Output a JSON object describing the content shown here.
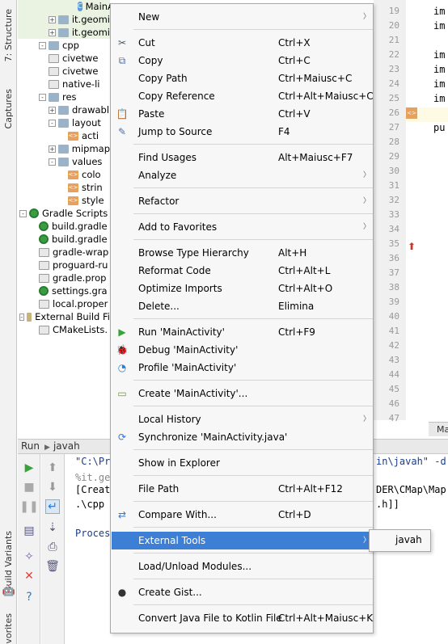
{
  "left_strip": {
    "tabs": [
      "7: Structure",
      "Captures",
      "Build Variants",
      "vorites"
    ]
  },
  "project_tree": {
    "rows": [
      {
        "label": "MainActivi",
        "icon": "class-icon",
        "indent": 6,
        "toggle": "",
        "hl": true
      },
      {
        "label": "it.geomi",
        "icon": "folder-icon",
        "indent": 3,
        "toggle": "+",
        "hl": true
      },
      {
        "label": "it.geomi",
        "icon": "folder-icon",
        "indent": 3,
        "toggle": "+",
        "hl": true
      },
      {
        "label": "cpp",
        "icon": "folder-icon",
        "indent": 2,
        "toggle": "-",
        "hl": false
      },
      {
        "label": "civetwe",
        "icon": "c-file-icon",
        "indent": 3,
        "toggle": "",
        "hl": false
      },
      {
        "label": "civetwe",
        "icon": "h-file-icon",
        "indent": 3,
        "toggle": "",
        "hl": false
      },
      {
        "label": "native-li",
        "icon": "cpp-file-icon",
        "indent": 3,
        "toggle": "",
        "hl": false
      },
      {
        "label": "res",
        "icon": "folder-icon",
        "indent": 2,
        "toggle": "-",
        "hl": false
      },
      {
        "label": "drawabl",
        "icon": "folder-icon",
        "indent": 3,
        "toggle": "+",
        "hl": false
      },
      {
        "label": "layout",
        "icon": "folder-icon",
        "indent": 3,
        "toggle": "-",
        "hl": false
      },
      {
        "label": "acti",
        "icon": "xml-file-icon",
        "indent": 5,
        "toggle": "",
        "hl": false
      },
      {
        "label": "mipmap",
        "icon": "folder-icon",
        "indent": 3,
        "toggle": "+",
        "hl": false
      },
      {
        "label": "values",
        "icon": "folder-icon",
        "indent": 3,
        "toggle": "-",
        "hl": false
      },
      {
        "label": "colo",
        "icon": "xml-file-icon",
        "indent": 5,
        "toggle": "",
        "hl": false
      },
      {
        "label": "strin",
        "icon": "xml-file-icon",
        "indent": 5,
        "toggle": "",
        "hl": false
      },
      {
        "label": "style",
        "icon": "xml-file-icon",
        "indent": 5,
        "toggle": "",
        "hl": false
      },
      {
        "label": "Gradle Scripts",
        "icon": "gradle-icon",
        "indent": 0,
        "toggle": "-",
        "hl": false
      },
      {
        "label": "build.gradle",
        "icon": "gradle-icon",
        "indent": 2,
        "toggle": "",
        "hl": false
      },
      {
        "label": "build.gradle",
        "icon": "gradle-icon",
        "indent": 2,
        "toggle": "",
        "hl": false
      },
      {
        "label": "gradle-wrap",
        "icon": "properties-icon",
        "indent": 2,
        "toggle": "",
        "hl": false
      },
      {
        "label": "proguard-ru",
        "icon": "text-file-icon",
        "indent": 2,
        "toggle": "",
        "hl": false
      },
      {
        "label": "gradle.prop",
        "icon": "properties-icon",
        "indent": 2,
        "toggle": "",
        "hl": false
      },
      {
        "label": "settings.gra",
        "icon": "gradle-icon",
        "indent": 2,
        "toggle": "",
        "hl": false
      },
      {
        "label": "local.proper",
        "icon": "properties-icon",
        "indent": 2,
        "toggle": "",
        "hl": false
      },
      {
        "label": "External Build Fi",
        "icon": "build-icon",
        "indent": 0,
        "toggle": "-",
        "hl": false
      },
      {
        "label": "CMakeLists.",
        "icon": "text-file-icon",
        "indent": 2,
        "toggle": "",
        "hl": false
      }
    ]
  },
  "editor": {
    "line_numbers": [
      "19",
      "20",
      "21",
      "22",
      "23",
      "24",
      "25",
      "26",
      "27",
      "28",
      "29",
      "30",
      "31",
      "32",
      "33",
      "34",
      "35",
      "36",
      "37",
      "38",
      "39",
      "40",
      "41",
      "42",
      "43",
      "44",
      "45",
      "46",
      "47"
    ],
    "code_lines": [
      {
        "line": "19",
        "text": "im"
      },
      {
        "line": "20",
        "text": "im"
      },
      {
        "line": "22",
        "text": "im"
      },
      {
        "line": "23",
        "text": "im"
      },
      {
        "line": "24",
        "text": "im"
      },
      {
        "line": "25",
        "text": "im"
      },
      {
        "line": "27",
        "text": "pu"
      }
    ],
    "tab_label": "Ma"
  },
  "run_panel": {
    "header_label": "Run",
    "config_label": "javah",
    "console_lines": [
      {
        "text": "\"C:\\Pr",
        "style": "blue"
      },
      {
        "text": "%it.ge",
        "style": "gray"
      },
      {
        "text": "[Creat",
        "style": "normal"
      },
      {
        "text": " .\\cpp",
        "style": "normal"
      },
      {
        "text": "",
        "style": "normal"
      },
      {
        "text": "Proces",
        "style": "blue"
      }
    ],
    "console_tail": [
      {
        "text": "in\\javah\" -d",
        "style": "blue"
      },
      {
        "text": "DER\\CMap\\Map",
        "style": "normal"
      },
      {
        "text": ".h]]",
        "style": "normal"
      }
    ]
  },
  "context_menu": {
    "items": [
      {
        "label": "New",
        "shortcut": "",
        "icon": "",
        "submenu": true
      },
      {
        "label": "Cut",
        "shortcut": "Ctrl+X",
        "icon": "scissors-icon",
        "submenu": false
      },
      {
        "label": "Copy",
        "shortcut": "Ctrl+C",
        "icon": "copy-icon",
        "submenu": false
      },
      {
        "label": "Copy Path",
        "shortcut": "Ctrl+Maiusc+C",
        "icon": "",
        "submenu": false
      },
      {
        "label": "Copy Reference",
        "shortcut": "Ctrl+Alt+Maiusc+C",
        "icon": "",
        "submenu": false
      },
      {
        "label": "Paste",
        "shortcut": "Ctrl+V",
        "icon": "paste-icon",
        "submenu": false
      },
      {
        "label": "Jump to Source",
        "shortcut": "F4",
        "icon": "jump-source-icon",
        "submenu": false
      },
      {
        "label": "Find Usages",
        "shortcut": "Alt+Maiusc+F7",
        "icon": "",
        "submenu": false
      },
      {
        "label": "Analyze",
        "shortcut": "",
        "icon": "",
        "submenu": true
      },
      {
        "label": "Refactor",
        "shortcut": "",
        "icon": "",
        "submenu": true
      },
      {
        "label": "Add to Favorites",
        "shortcut": "",
        "icon": "",
        "submenu": true
      },
      {
        "label": "Browse Type Hierarchy",
        "shortcut": "Alt+H",
        "icon": "",
        "submenu": false
      },
      {
        "label": "Reformat Code",
        "shortcut": "Ctrl+Alt+L",
        "icon": "",
        "submenu": false
      },
      {
        "label": "Optimize Imports",
        "shortcut": "Ctrl+Alt+O",
        "icon": "",
        "submenu": false
      },
      {
        "label": "Delete...",
        "shortcut": "Elimina",
        "icon": "",
        "submenu": false
      },
      {
        "label": "Run 'MainActivity'",
        "shortcut": "Ctrl+F9",
        "icon": "run-icon",
        "submenu": false
      },
      {
        "label": "Debug 'MainActivity'",
        "shortcut": "",
        "icon": "debug-icon",
        "submenu": false
      },
      {
        "label": "Profile 'MainActivity'",
        "shortcut": "",
        "icon": "profile-icon",
        "submenu": false
      },
      {
        "label": "Create 'MainActivity'...",
        "shortcut": "",
        "icon": "create-config-icon",
        "submenu": false
      },
      {
        "label": "Local History",
        "shortcut": "",
        "icon": "",
        "submenu": true
      },
      {
        "label": "Synchronize 'MainActivity.java'",
        "shortcut": "",
        "icon": "sync-icon",
        "submenu": false
      },
      {
        "label": "Show in Explorer",
        "shortcut": "",
        "icon": "",
        "submenu": false
      },
      {
        "label": "File Path",
        "shortcut": "Ctrl+Alt+F12",
        "icon": "",
        "submenu": false
      },
      {
        "label": "Compare With...",
        "shortcut": "Ctrl+D",
        "icon": "compare-icon",
        "submenu": false
      },
      {
        "label": "External Tools",
        "shortcut": "",
        "icon": "",
        "submenu": true,
        "selected": true
      },
      {
        "label": "Load/Unload Modules...",
        "shortcut": "",
        "icon": "",
        "submenu": false
      },
      {
        "label": "Create Gist...",
        "shortcut": "",
        "icon": "github-icon",
        "submenu": false
      },
      {
        "label": "Convert Java File to Kotlin File",
        "shortcut": "Ctrl+Alt+Maiusc+K",
        "icon": "",
        "submenu": false
      }
    ]
  },
  "external_tools_submenu": {
    "items": [
      "javah"
    ]
  },
  "colors": {
    "selection": "#3d7fd5",
    "run_green": "#3aa23a",
    "stop_red": "#d9443a"
  }
}
